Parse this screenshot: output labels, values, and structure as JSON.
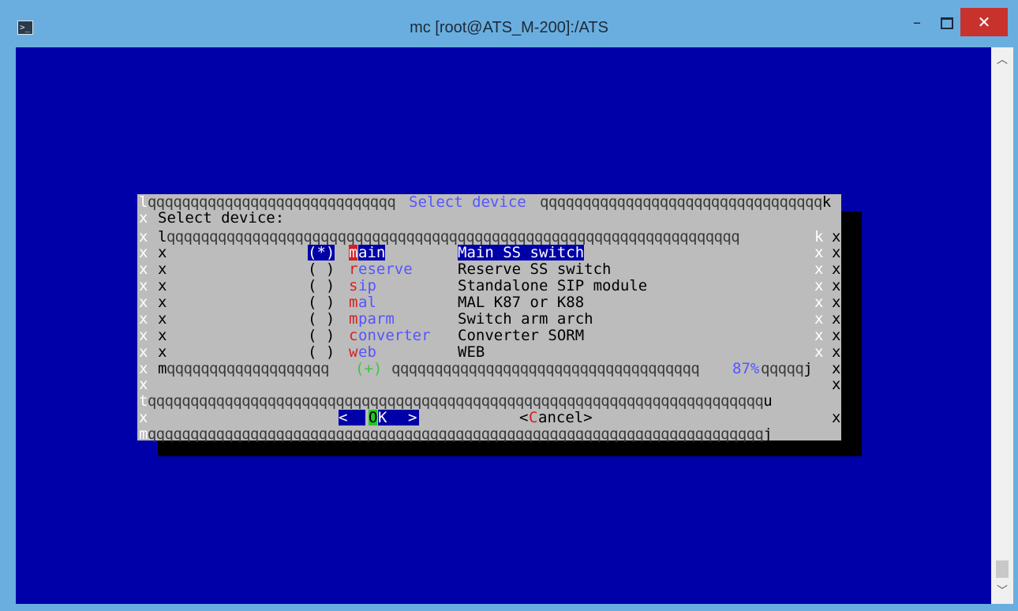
{
  "window": {
    "title": "mc [root@ATS_M-200]:/ATS",
    "minimize": "–",
    "close": "✕"
  },
  "dialog": {
    "frame_title": "Select device",
    "prompt": "Select device:",
    "scroll_percent": "87%",
    "scroll_marker": "(+)",
    "radio_items": [
      {
        "mark": "(*)",
        "hot": "m",
        "rest": "ain",
        "desc": "Main SS switch",
        "selected": true
      },
      {
        "mark": "( )",
        "hot": "r",
        "rest": "eserve",
        "desc": "Reserve SS switch",
        "selected": false
      },
      {
        "mark": "( )",
        "hot": "s",
        "rest": "ip",
        "desc": "Standalone SIP module",
        "selected": false
      },
      {
        "mark": "( )",
        "hot": "m",
        "rest": "al",
        "desc": "MAL K87 or K88",
        "selected": false
      },
      {
        "mark": "( )",
        "hot": "m",
        "rest": "parm",
        "desc": "Switch arm arch",
        "selected": false
      },
      {
        "mark": "( )",
        "hot": "c",
        "rest": "onverter",
        "desc": "Converter SORM",
        "selected": false
      },
      {
        "mark": "( )",
        "hot": "w",
        "rest": "eb",
        "desc": "WEB",
        "selected": false
      }
    ],
    "ok_left": "<",
    "ok_hot": "O",
    "ok_rest": "K",
    "ok_right": ">",
    "cancel_left": "<",
    "cancel_hot": "C",
    "cancel_rest": "ancel>"
  },
  "colors": {
    "terminal_bg": "#0000a8",
    "dialog_bg": "#bcbcbc",
    "hotkey": "#d42020",
    "highlight_text": "#5555ff"
  },
  "icons": {
    "app": "terminal-icon",
    "scroll_up": "chevron-up-icon",
    "scroll_down": "chevron-down-icon"
  }
}
